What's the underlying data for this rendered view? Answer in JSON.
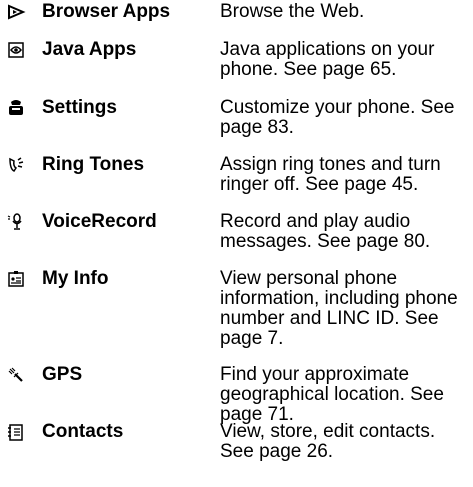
{
  "menu": {
    "items": [
      {
        "icon": "browser-icon",
        "name": "Browser Apps",
        "description": "Browse the Web."
      },
      {
        "icon": "java-icon",
        "name": "Java Apps",
        "description": "Java applications on your phone. See page 65."
      },
      {
        "icon": "settings-icon",
        "name": "Settings",
        "description": "Customize your phone. See page 83."
      },
      {
        "icon": "ring-tones-icon",
        "name": "Ring Tones",
        "description": "Assign ring tones and turn ringer off. See page 45."
      },
      {
        "icon": "voice-record-icon",
        "name": "VoiceRecord",
        "description": "Record and play audio messages. See page 80."
      },
      {
        "icon": "my-info-icon",
        "name": "My Info",
        "description": "View personal phone information, including phone number and LINC ID. See page 7."
      },
      {
        "icon": "gps-icon",
        "name": "GPS",
        "description": "Find your approximate geographical location. See page 71."
      },
      {
        "icon": "contacts-icon",
        "name": "Contacts",
        "description": "View, store, edit contacts. See page 26."
      }
    ]
  }
}
